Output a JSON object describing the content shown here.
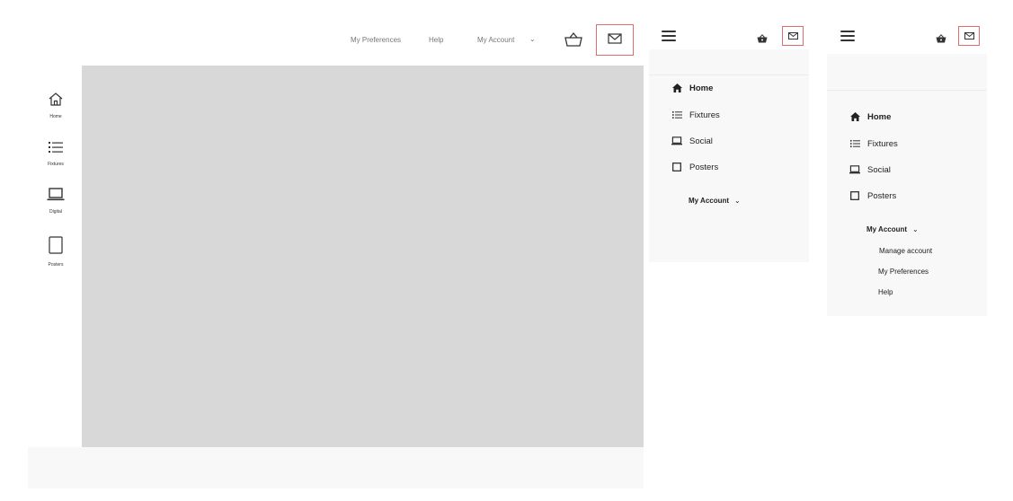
{
  "desktop": {
    "nav": {
      "preferences_label": "My Preferences",
      "help_label": "Help",
      "account_label": "My Account"
    },
    "icons": {
      "basket": "basket-icon",
      "mail": "mail-icon"
    },
    "sidebar": {
      "items": [
        {
          "label": "Home",
          "icon": "home-icon"
        },
        {
          "label": "Fixtures",
          "icon": "list-icon"
        },
        {
          "label": "Digital",
          "icon": "laptop-icon"
        },
        {
          "label": "Posters",
          "icon": "poster-icon"
        }
      ]
    }
  },
  "mobile_collapsed": {
    "menu": [
      {
        "label": "Home",
        "icon": "home-icon"
      },
      {
        "label": "Fixtures",
        "icon": "list-icon"
      },
      {
        "label": "Social",
        "icon": "laptop-icon"
      },
      {
        "label": "Posters",
        "icon": "poster-icon"
      }
    ],
    "account_label": "My Account"
  },
  "mobile_expanded": {
    "menu": [
      {
        "label": "Home",
        "icon": "home-icon"
      },
      {
        "label": "Fixtures",
        "icon": "list-icon"
      },
      {
        "label": "Social",
        "icon": "laptop-icon"
      },
      {
        "label": "Posters",
        "icon": "poster-icon"
      }
    ],
    "account_label": "My Account",
    "account_submenu": [
      "Manage account",
      "My Preferences",
      "Help"
    ]
  },
  "colors": {
    "highlight_border": "#e26a6a",
    "content_placeholder": "#d8d8d8",
    "panel_background": "#f8f8f8"
  }
}
